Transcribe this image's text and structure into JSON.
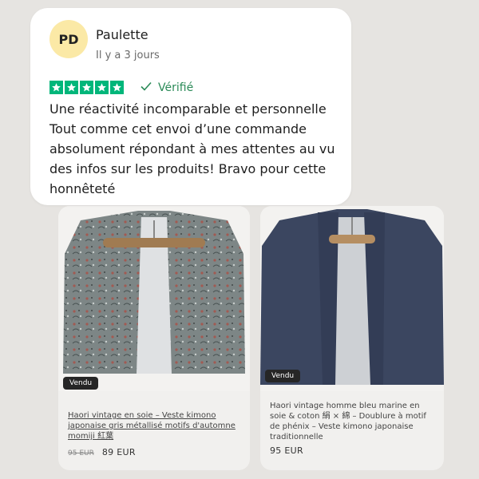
{
  "review": {
    "initials": "PD",
    "name": "Paulette",
    "date": "Il y a 3 jours",
    "rating": 5,
    "verified_label": "Vérifié",
    "text": "Une réactivité incomparable et personnelle Tout comme cet envoi d’une commande absolument répondant à mes attentes au vu des infos sur les produits! Bravo pour cette honnêteté",
    "colors": {
      "star": "#00b67a",
      "verified": "#2a8a57",
      "avatar_bg": "#fbe9a6"
    },
    "icons": {
      "star": "star-icon",
      "verified": "checkmark-icon"
    }
  },
  "products": [
    {
      "badge": "Vendu",
      "title": "Haori vintage en soie – Veste kimono japonaise gris métallisé motifs d'automne momiji 紅葉",
      "old_price": "95 EUR",
      "price": "89 EUR"
    },
    {
      "badge": "Vendu",
      "title": "Haori vintage homme bleu marine en soie & coton 絹 × 綿 – Doublure à motif de phénix – Veste kimono japonaise traditionnelle",
      "price": "95 EUR"
    }
  ]
}
